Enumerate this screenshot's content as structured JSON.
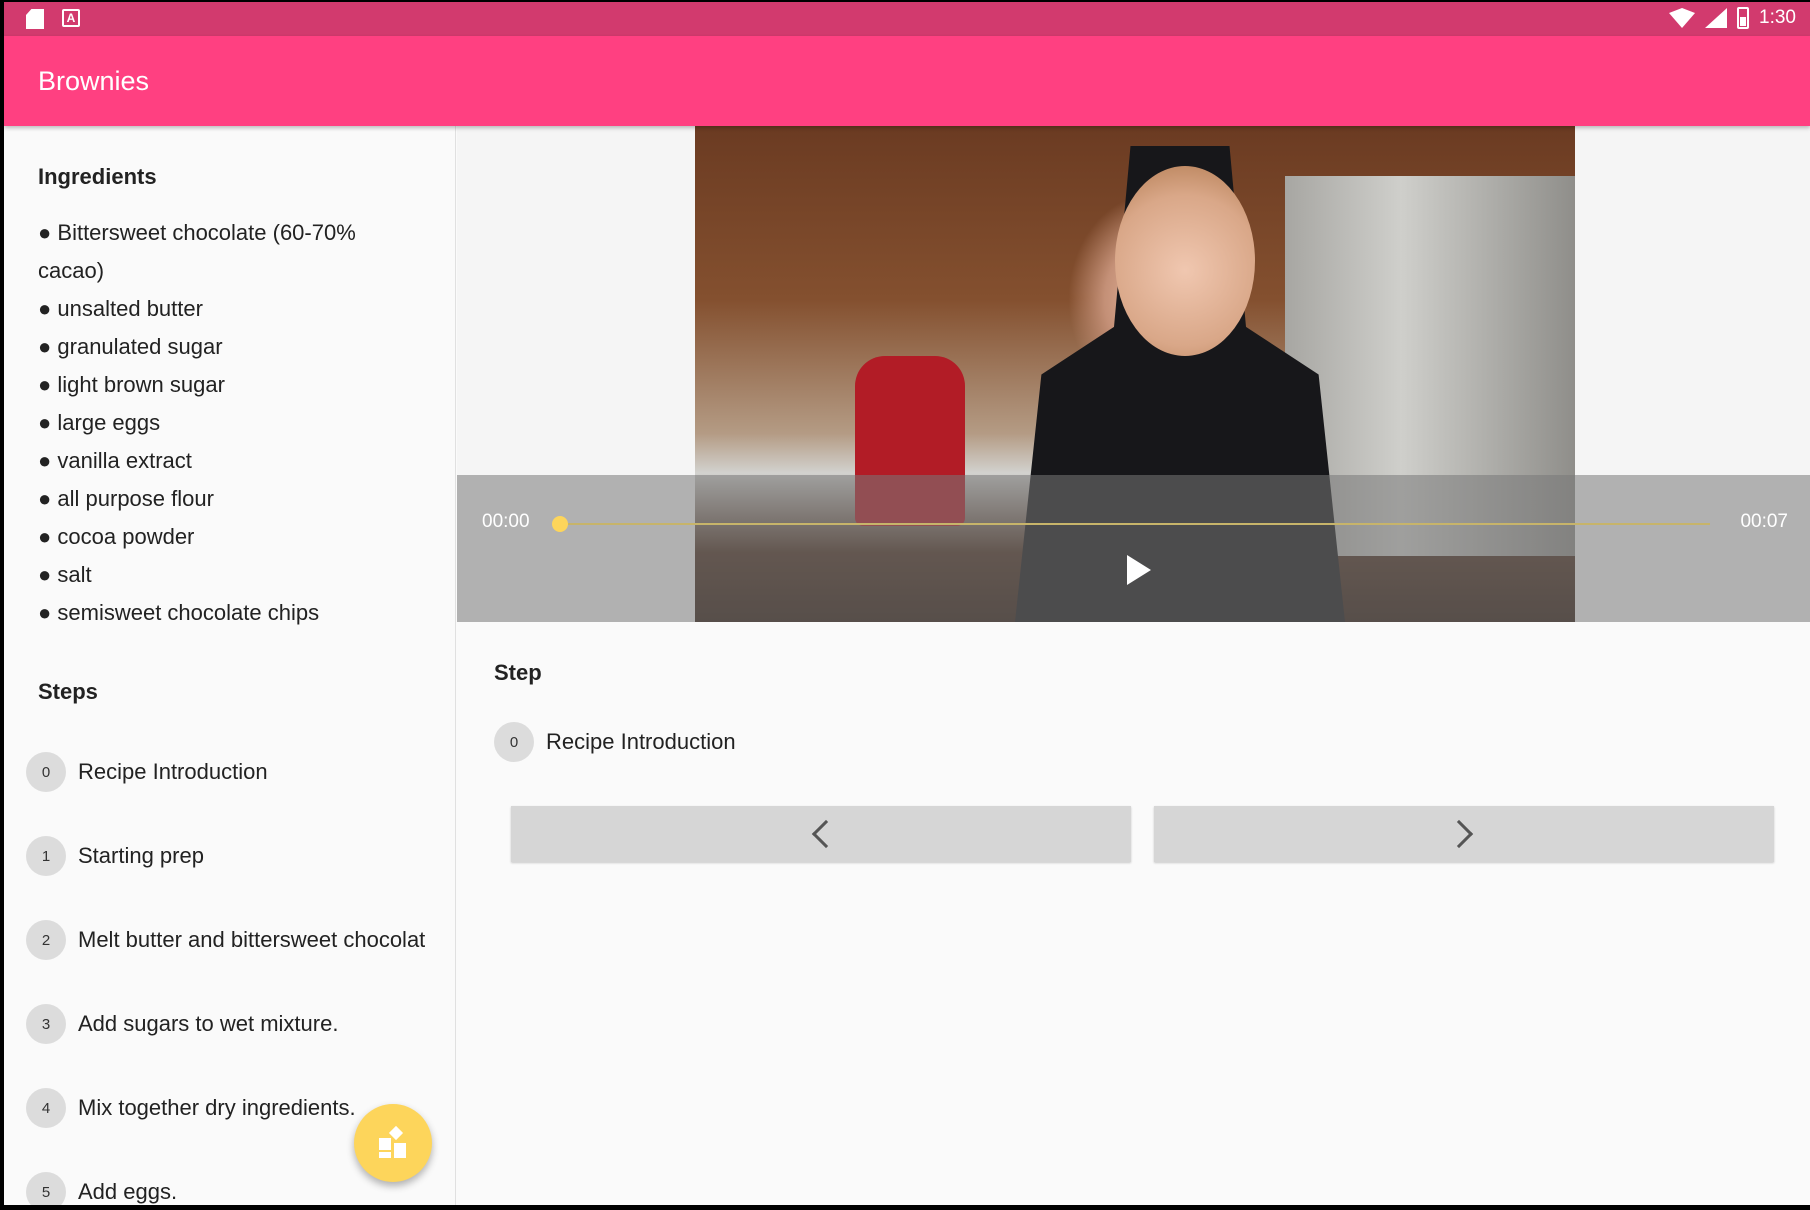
{
  "status_bar": {
    "time": "1:30",
    "left_icons": [
      "sd-card-icon",
      "keyboard-a-icon"
    ],
    "right_icons": [
      "wifi-icon",
      "cell-signal-icon",
      "battery-charging-icon"
    ]
  },
  "app_bar": {
    "title": "Brownies",
    "color": "#ff4081"
  },
  "ingredients": {
    "title": "Ingredients",
    "items": [
      "● Bittersweet chocolate (60-70% cacao)",
      "● unsalted butter",
      "● granulated sugar",
      "● light brown sugar",
      "● large eggs",
      "● vanilla extract",
      "● all purpose flour",
      "● cocoa powder",
      "● salt",
      "● semisweet chocolate chips"
    ]
  },
  "steps": {
    "title": "Steps",
    "items": [
      {
        "num": "0",
        "label": "Recipe Introduction"
      },
      {
        "num": "1",
        "label": "Starting prep"
      },
      {
        "num": "2",
        "label": "Melt butter and bittersweet chocolat"
      },
      {
        "num": "3",
        "label": "Add sugars to wet mixture."
      },
      {
        "num": "4",
        "label": "Mix together dry ingredients."
      },
      {
        "num": "5",
        "label": "Add eggs."
      }
    ]
  },
  "fab": {
    "icon": "widgets-icon",
    "color": "#fdd55b"
  },
  "player": {
    "position": "00:00",
    "duration": "00:07",
    "progress": 0.0,
    "play_icon": "play-icon"
  },
  "step_detail": {
    "title": "Step",
    "num": "0",
    "label": "Recipe Introduction",
    "prev_icon": "chevron-left-icon",
    "next_icon": "chevron-right-icon"
  }
}
